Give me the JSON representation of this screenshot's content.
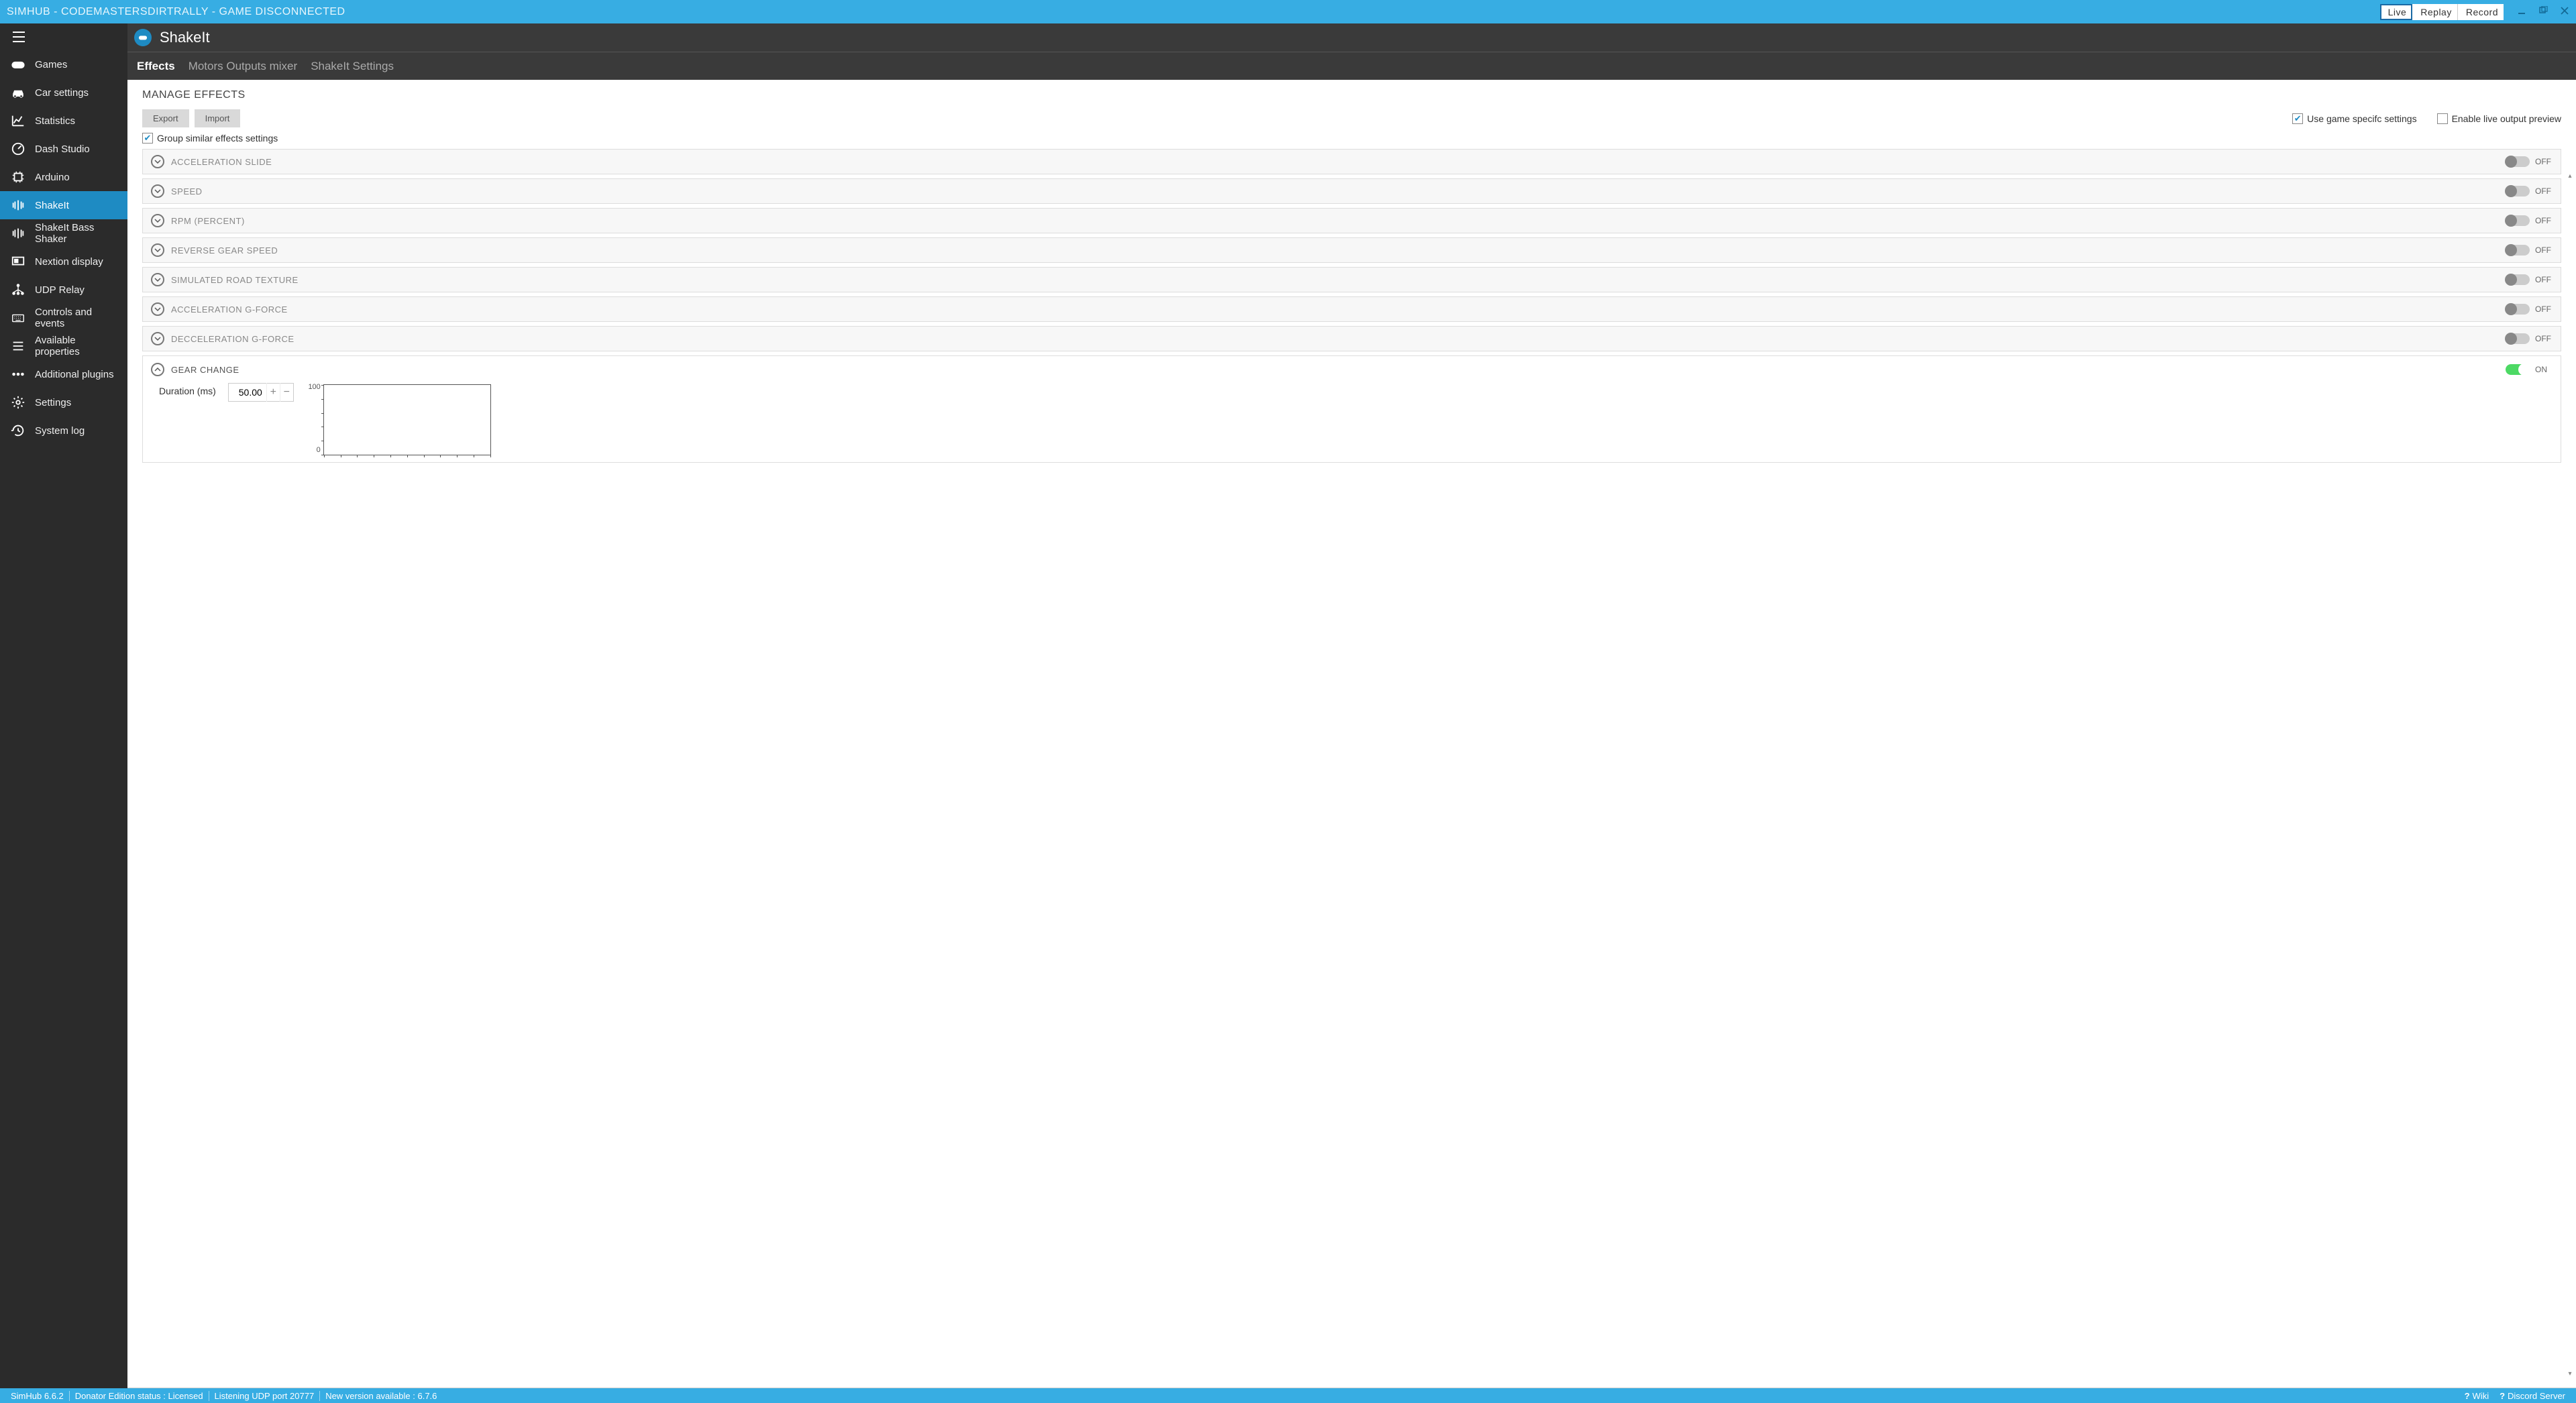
{
  "titlebar": {
    "title": "SIMHUB - CODEMASTERSDIRTRALLY - GAME DISCONNECTED",
    "live": "Live",
    "replay": "Replay",
    "record": "Record"
  },
  "sidebar": {
    "items": [
      {
        "key": "games",
        "label": "Games"
      },
      {
        "key": "car-settings",
        "label": "Car settings"
      },
      {
        "key": "statistics",
        "label": "Statistics"
      },
      {
        "key": "dash-studio",
        "label": "Dash Studio"
      },
      {
        "key": "arduino",
        "label": "Arduino"
      },
      {
        "key": "shakeit",
        "label": "ShakeIt"
      },
      {
        "key": "shakeit-bass",
        "label": "ShakeIt Bass Shaker"
      },
      {
        "key": "nextion",
        "label": "Nextion display"
      },
      {
        "key": "udp-relay",
        "label": "UDP Relay"
      },
      {
        "key": "controls-events",
        "label": "Controls and events"
      },
      {
        "key": "available-properties",
        "label": "Available properties"
      },
      {
        "key": "additional-plugins",
        "label": "Additional plugins"
      },
      {
        "key": "settings",
        "label": "Settings"
      },
      {
        "key": "system-log",
        "label": "System log"
      }
    ]
  },
  "header": {
    "title": "ShakeIt"
  },
  "tabs": {
    "effects": "Effects",
    "motors": "Motors Outputs mixer",
    "settings": "ShakeIt Settings"
  },
  "section": {
    "title": "MANAGE EFFECTS",
    "export": "Export",
    "import": "Import",
    "group_similar": "Group similar effects settings",
    "use_game_specific": "Use game specifc settings",
    "enable_preview": "Enable live output preview"
  },
  "effects": [
    {
      "label": "ACCELERATION SLIDE",
      "state": "OFF"
    },
    {
      "label": "SPEED",
      "state": "OFF"
    },
    {
      "label": "RPM (PERCENT)",
      "state": "OFF"
    },
    {
      "label": "REVERSE GEAR SPEED",
      "state": "OFF"
    },
    {
      "label": "SIMULATED ROAD TEXTURE",
      "state": "OFF"
    },
    {
      "label": "ACCELERATION G-FORCE",
      "state": "OFF"
    },
    {
      "label": "DECCELERATION G-FORCE",
      "state": "OFF"
    }
  ],
  "gear_change": {
    "label": "GEAR CHANGE",
    "state": "ON",
    "duration_label": "Duration (ms)",
    "duration_value": "50.00"
  },
  "chart_data": {
    "type": "line",
    "title": "",
    "xlabel": "",
    "ylabel": "",
    "ylim": [
      0,
      100
    ],
    "x": [],
    "values": []
  },
  "status": {
    "version": "SimHub 6.6.2",
    "license": "Donator Edition status :  Licensed",
    "udp": "Listening UDP port 20777",
    "update": "New version available : 6.7.6",
    "wiki": "Wiki",
    "discord": "Discord Server"
  }
}
